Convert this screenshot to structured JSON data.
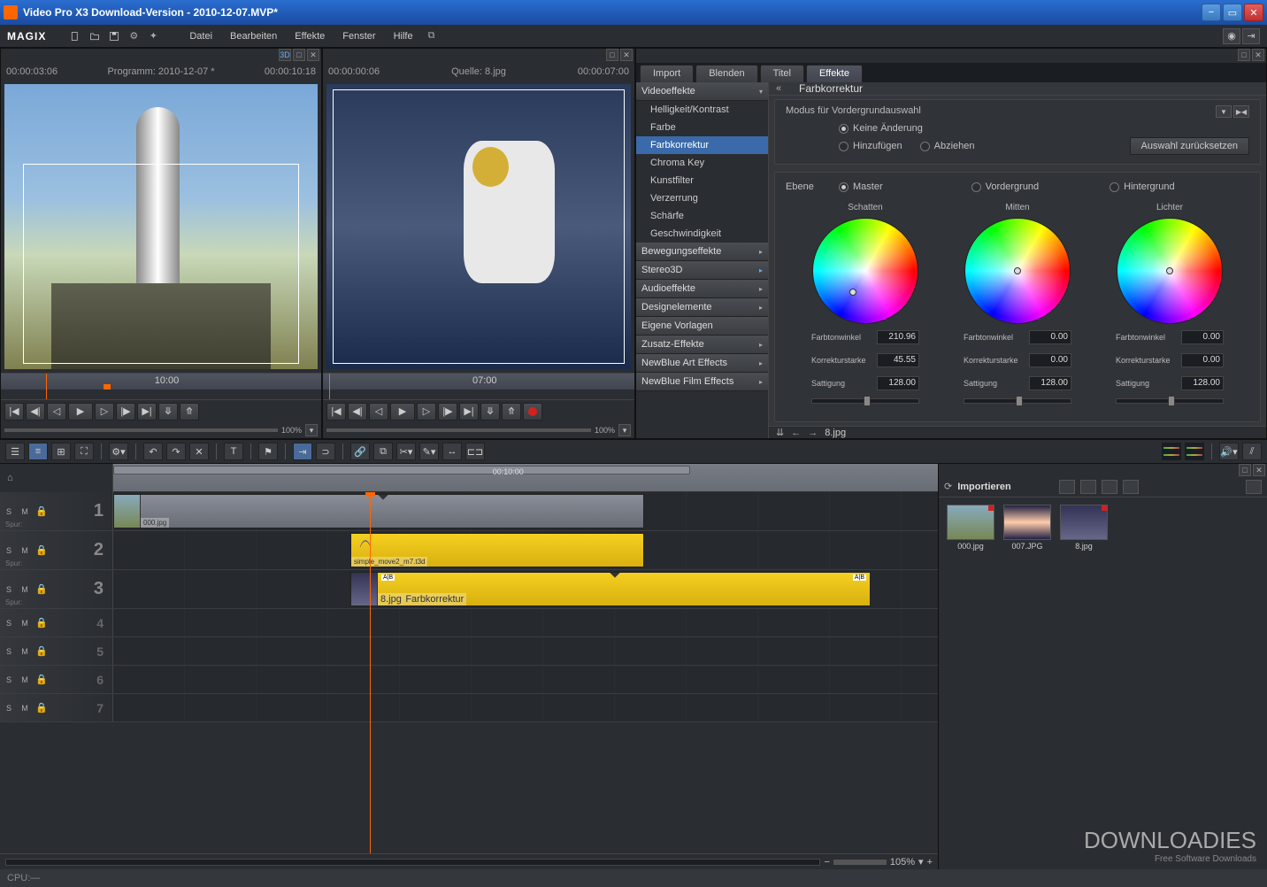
{
  "window": {
    "title": "Video Pro X3 Download-Version - 2010-12-07.MVP*"
  },
  "brand": "MAGIX",
  "menu": {
    "datei": "Datei",
    "bearbeiten": "Bearbeiten",
    "effekte": "Effekte",
    "fenster": "Fenster",
    "hilfe": "Hilfe"
  },
  "preview": {
    "left": {
      "tc_in": "00:00:03:06",
      "name": "Programm: 2010-12-07 *",
      "tc_out": "00:00:10:18",
      "ruler_mark": "10:00",
      "zoom": "100%"
    },
    "right": {
      "tc_in": "00:00:00:06",
      "name": "Quelle: 8.jpg",
      "tc_out": "00:00:07:00",
      "ruler_mark": "07:00",
      "zoom": "100%"
    }
  },
  "effects": {
    "tabs": {
      "import": "Import",
      "blenden": "Blenden",
      "titel": "Titel",
      "effekte": "Effekte"
    },
    "categories": {
      "videoeffekte": "Videoeffekte",
      "bewegungseffekte": "Bewegungseffekte",
      "stereo3d": "Stereo3D",
      "audioeffekte": "Audioeffekte",
      "designelemente": "Designelemente",
      "eigene_vorlagen": "Eigene Vorlagen",
      "zusatz": "Zusatz-Effekte",
      "newblue_art": "NewBlue Art Effects",
      "newblue_film": "NewBlue Film Effects"
    },
    "video_items": {
      "helligkeit": "Helligkeit/Kontrast",
      "farbe": "Farbe",
      "farbkorrektur": "Farbkorrektur",
      "chroma": "Chroma Key",
      "kunstfilter": "Kunstfilter",
      "verzerrung": "Verzerrung",
      "schaerfe": "Schärfe",
      "geschwindigkeit": "Geschwindigkeit"
    },
    "detail": {
      "title": "Farbkorrektur",
      "modus_label": "Modus für Vordergrundauswahl",
      "modus_none": "Keine Änderung",
      "modus_add": "Hinzufügen",
      "modus_sub": "Abziehen",
      "reset": "Auswahl zurücksetzen",
      "ebene": "Ebene",
      "ebene_master": "Master",
      "ebene_fg": "Vordergrund",
      "ebene_bg": "Hintergrund",
      "wheels": {
        "schatten": "Schatten",
        "mitten": "Mitten",
        "lichter": "Lichter"
      },
      "params": {
        "farbtonwinkel": "Farbtonwinkel",
        "korrekturstarke": "Korrekturstarke",
        "sattigung": "Sattigung"
      },
      "values": {
        "schatten": {
          "winkel": "210.96",
          "starke": "45.55",
          "sat": "128.00"
        },
        "mitten": {
          "winkel": "0.00",
          "starke": "0.00",
          "sat": "128.00"
        },
        "lichter": {
          "winkel": "0.00",
          "starke": "0.00",
          "sat": "128.00"
        }
      },
      "footer_file": "8.jpg"
    }
  },
  "import": {
    "title": "Importieren",
    "thumbs": [
      {
        "name": "000.jpg"
      },
      {
        "name": "007.JPG"
      },
      {
        "name": "8.jpg"
      }
    ]
  },
  "timeline": {
    "ruler_center": "00:10:00",
    "track_label": "Spur:",
    "zoom_pct": "105%",
    "clips": {
      "t1_name": "000.jpg",
      "t2_name": "simple_move2_m7.t3d",
      "t3_name": "8.jpg",
      "t3_effect": "Farbkorrektur",
      "ab": "A|B"
    }
  },
  "status": {
    "cpu": "CPU:—"
  },
  "watermark": {
    "line1": "DOWNLOADIES",
    "line2": "Free Software Downloads"
  }
}
